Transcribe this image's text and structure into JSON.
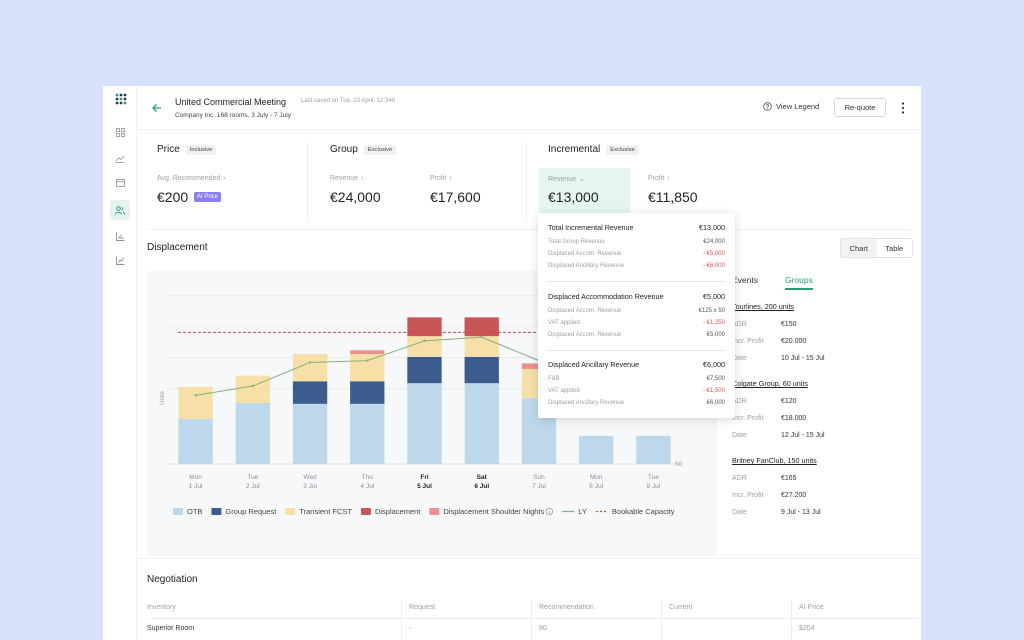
{
  "header": {
    "title": "United Commercial Meeting",
    "saved": "Last saved on Tue, 23 April, 12:34h",
    "subtitle": "Company Inc, 168 rooms, 3 July - 7 July",
    "view_legend": "View Legend",
    "requote": "Re-quote"
  },
  "kpis": {
    "price": {
      "title": "Price",
      "tag": "Inclusive",
      "label": "Avg. Recommended",
      "value": "€200",
      "badge": "AI Price"
    },
    "group": {
      "title": "Group",
      "tag": "Exclusive",
      "revenue_label": "Revenue",
      "revenue": "€24,000",
      "profit_label": "Profit",
      "profit": "€17,600"
    },
    "incremental": {
      "title": "Incremental",
      "tag": "Exclusive",
      "revenue_label": "Revenue",
      "revenue": "€13,000",
      "profit_label": "Profit",
      "profit": "€11,850"
    }
  },
  "displacement": {
    "title": "Displacement",
    "view_chart": "Chart",
    "view_table": "Table",
    "y_axis_label": "Units",
    "y_tick": "50"
  },
  "chart_data": {
    "type": "bar",
    "categories": [
      {
        "day": "Mon",
        "date": "1 Jul",
        "bold": false
      },
      {
        "day": "Tue",
        "date": "2 Jul",
        "bold": false
      },
      {
        "day": "Wed",
        "date": "3 Jul",
        "bold": false
      },
      {
        "day": "Thu",
        "date": "4 Jul",
        "bold": false
      },
      {
        "day": "Fri",
        "date": "5 Jul",
        "bold": true
      },
      {
        "day": "Sat",
        "date": "6 Jul",
        "bold": true
      },
      {
        "day": "Sun",
        "date": "7 Jul",
        "bold": false
      },
      {
        "day": "Mon",
        "date": "8 Jul",
        "bold": false
      },
      {
        "day": "Tue",
        "date": "9 Jul",
        "bold": false
      }
    ],
    "series": [
      {
        "name": "OTB",
        "color": "#bcd8ea",
        "values": [
          48,
          65,
          64,
          64,
          86,
          86,
          70,
          30,
          30
        ]
      },
      {
        "name": "Group Request",
        "color": "#3c5b8f",
        "values": [
          0,
          0,
          24,
          24,
          28,
          28,
          0,
          0,
          0
        ]
      },
      {
        "name": "Transient FCST",
        "color": "#f7e0a8",
        "values": [
          34,
          29,
          29,
          29,
          22,
          22,
          31,
          0,
          0
        ]
      },
      {
        "name": "Displacement",
        "color": "#c95656",
        "values": [
          0,
          0,
          0,
          0,
          20,
          20,
          0,
          0,
          0
        ]
      },
      {
        "name": "Displacement Shoulder Nights",
        "color": "#ec8f8f",
        "values": [
          0,
          0,
          0,
          4,
          0,
          0,
          6,
          0,
          0
        ]
      }
    ],
    "ly": {
      "name": "LY",
      "color": "#86b07c",
      "values": [
        73,
        83,
        108,
        110,
        131,
        135,
        110,
        null,
        null
      ]
    },
    "capacity": {
      "name": "Bookable Capacity",
      "color": "#d94040",
      "value": 140
    },
    "ylim": [
      0,
      200
    ],
    "legend_info_icon": "info-icon"
  },
  "side": {
    "tab_events": "Events",
    "tab_groups": "Groups",
    "groups": [
      {
        "name": "Tourlines, 200 units",
        "rows": [
          {
            "k": "ADR",
            "v": "€150"
          },
          {
            "k": "Incr. Profit",
            "v": "€20.000"
          },
          {
            "k": "Date",
            "v": "10 Jul - 15 Jul"
          }
        ]
      },
      {
        "name": "Colgate Group, 60 units",
        "rows": [
          {
            "k": "ADR",
            "v": "€120"
          },
          {
            "k": "Incr. Profit",
            "v": "€18.000"
          },
          {
            "k": "Date",
            "v": "12 Jul - 15 Jul"
          }
        ]
      },
      {
        "name": "Britney FanClub, 150 units",
        "rows": [
          {
            "k": "ADR",
            "v": "€165"
          },
          {
            "k": "Incr. Profit",
            "v": "€27.200"
          },
          {
            "k": "Date",
            "v": "9 Jul - 13 Jul"
          }
        ]
      }
    ]
  },
  "popover": {
    "sections": [
      {
        "title": "Total Incremental Revenue",
        "value": "€13,000",
        "rows": [
          {
            "k": "Total Group Revenue",
            "v": "€24,000",
            "neg": false
          },
          {
            "k": "Displaced Accom. Revenue",
            "v": "- €5,000",
            "neg": true
          },
          {
            "k": "Displaced Ancillary Revenue",
            "v": "- €6,000",
            "neg": true
          }
        ]
      },
      {
        "title": "Displaced Accommodation Revenue",
        "value": "€5,000",
        "rows": [
          {
            "k": "Displaced Accom. Revenue",
            "v": "€125 x 50",
            "neg": false
          },
          {
            "k": "VAT applied",
            "v": "- €1,250",
            "neg": true
          },
          {
            "k": "Displaced Accom. Revenue",
            "v": "€5,000",
            "neg": false
          }
        ]
      },
      {
        "title": "Displaced Ancillary Revenue",
        "value": "€6,000",
        "rows": [
          {
            "k": "F&B",
            "v": "€7,500",
            "neg": false
          },
          {
            "k": "VAT applied",
            "v": "- €1,500",
            "neg": true
          },
          {
            "k": "Displaced Ancillary Revenue",
            "v": "€6,000",
            "neg": false
          }
        ]
      }
    ]
  },
  "negotiation": {
    "title": "Negotiation",
    "headers": [
      "Inventory",
      "Request",
      "Recommendation",
      "Current",
      "AI Price"
    ],
    "row": [
      "Superior Room",
      "-",
      "80",
      "",
      "$204"
    ]
  }
}
